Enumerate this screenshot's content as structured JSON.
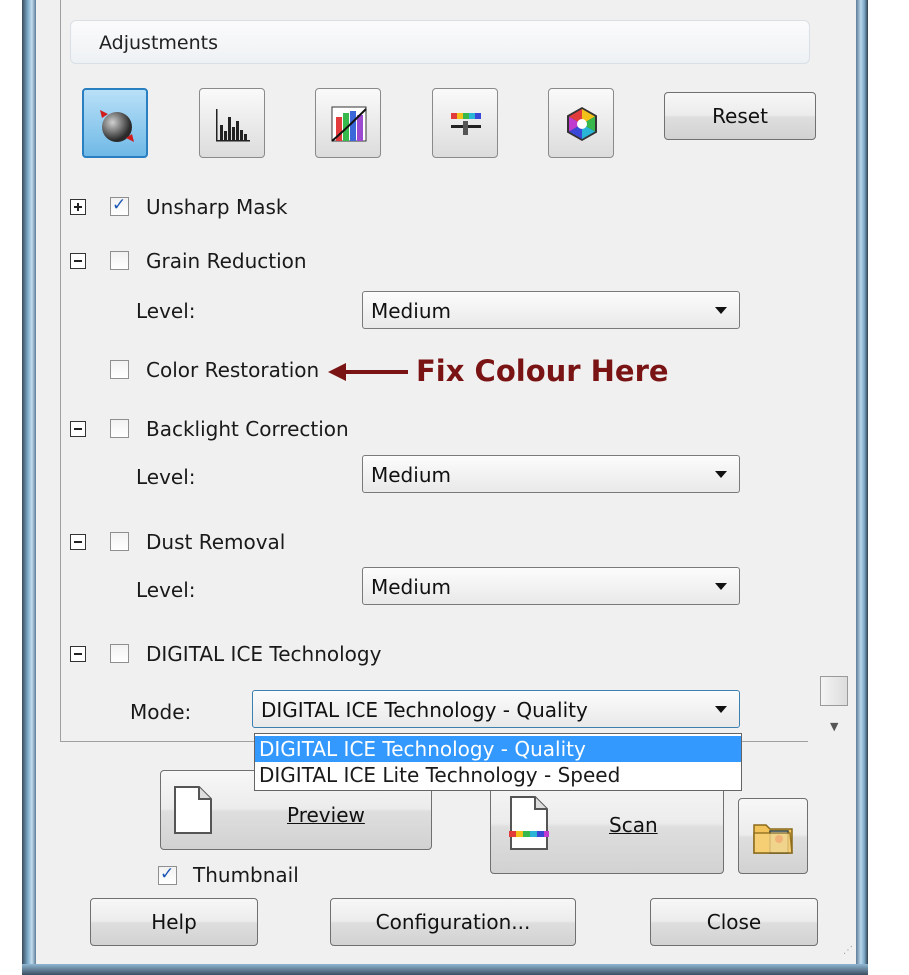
{
  "section_title": "Adjustments",
  "toolbar": {
    "tools": [
      {
        "icon": "auto-exposure-icon",
        "active": true
      },
      {
        "icon": "histogram-icon",
        "active": false
      },
      {
        "icon": "tone-curve-icon",
        "active": false
      },
      {
        "icon": "color-balance-icon",
        "active": false
      },
      {
        "icon": "color-palette-icon",
        "active": false
      }
    ],
    "reset_label": "Reset"
  },
  "options": {
    "unsharp_mask": {
      "label": "Unsharp Mask",
      "checked": true,
      "expander": "+"
    },
    "grain_reduction": {
      "label": "Grain Reduction",
      "checked": false,
      "expander": "−",
      "level_label": "Level:",
      "level_value": "Medium"
    },
    "color_restoration": {
      "label": "Color Restoration",
      "checked": false
    },
    "backlight_correction": {
      "label": "Backlight Correction",
      "checked": false,
      "expander": "−",
      "level_label": "Level:",
      "level_value": "Medium"
    },
    "dust_removal": {
      "label": "Dust Removal",
      "checked": false,
      "expander": "−",
      "level_label": "Level:",
      "level_value": "Medium"
    },
    "digital_ice": {
      "label": "DIGITAL ICE Technology",
      "checked": false,
      "expander": "−",
      "mode_label": "Mode:",
      "mode_value": "DIGITAL ICE Technology - Quality"
    }
  },
  "mode_dropdown": {
    "options": [
      "DIGITAL ICE Technology - Quality",
      "DIGITAL ICE Lite Technology - Speed"
    ],
    "selected_index": 0
  },
  "annotation": {
    "text": "Fix Colour Here",
    "color": "#7a1414"
  },
  "actions": {
    "preview_label": "Preview",
    "scan_label": "Scan",
    "thumbnail_label": "Thumbnail",
    "thumbnail_checked": true,
    "help_label": "Help",
    "configuration_label": "Configuration...",
    "close_label": "Close"
  },
  "colors": {
    "selection": "#3399ff",
    "active_tool": "#6fb9e6",
    "window_frame": "#7aa8c8"
  }
}
